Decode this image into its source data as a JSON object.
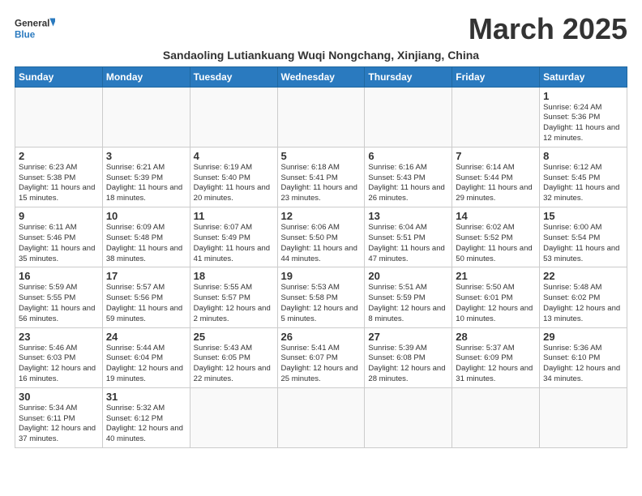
{
  "header": {
    "logo_general": "General",
    "logo_blue": "Blue",
    "month_title": "March 2025",
    "subtitle": "Sandaoling Lutiankuang Wuqi Nongchang, Xinjiang, China"
  },
  "weekdays": [
    "Sunday",
    "Monday",
    "Tuesday",
    "Wednesday",
    "Thursday",
    "Friday",
    "Saturday"
  ],
  "weeks": [
    [
      {
        "day": "",
        "info": ""
      },
      {
        "day": "",
        "info": ""
      },
      {
        "day": "",
        "info": ""
      },
      {
        "day": "",
        "info": ""
      },
      {
        "day": "",
        "info": ""
      },
      {
        "day": "",
        "info": ""
      },
      {
        "day": "1",
        "info": "Sunrise: 6:24 AM\nSunset: 5:36 PM\nDaylight: 11 hours\nand 12 minutes."
      }
    ],
    [
      {
        "day": "2",
        "info": "Sunrise: 6:23 AM\nSunset: 5:38 PM\nDaylight: 11 hours\nand 15 minutes."
      },
      {
        "day": "3",
        "info": "Sunrise: 6:21 AM\nSunset: 5:39 PM\nDaylight: 11 hours\nand 18 minutes."
      },
      {
        "day": "4",
        "info": "Sunrise: 6:19 AM\nSunset: 5:40 PM\nDaylight: 11 hours\nand 20 minutes."
      },
      {
        "day": "5",
        "info": "Sunrise: 6:18 AM\nSunset: 5:41 PM\nDaylight: 11 hours\nand 23 minutes."
      },
      {
        "day": "6",
        "info": "Sunrise: 6:16 AM\nSunset: 5:43 PM\nDaylight: 11 hours\nand 26 minutes."
      },
      {
        "day": "7",
        "info": "Sunrise: 6:14 AM\nSunset: 5:44 PM\nDaylight: 11 hours\nand 29 minutes."
      },
      {
        "day": "8",
        "info": "Sunrise: 6:12 AM\nSunset: 5:45 PM\nDaylight: 11 hours\nand 32 minutes."
      }
    ],
    [
      {
        "day": "9",
        "info": "Sunrise: 6:11 AM\nSunset: 5:46 PM\nDaylight: 11 hours\nand 35 minutes."
      },
      {
        "day": "10",
        "info": "Sunrise: 6:09 AM\nSunset: 5:48 PM\nDaylight: 11 hours\nand 38 minutes."
      },
      {
        "day": "11",
        "info": "Sunrise: 6:07 AM\nSunset: 5:49 PM\nDaylight: 11 hours\nand 41 minutes."
      },
      {
        "day": "12",
        "info": "Sunrise: 6:06 AM\nSunset: 5:50 PM\nDaylight: 11 hours\nand 44 minutes."
      },
      {
        "day": "13",
        "info": "Sunrise: 6:04 AM\nSunset: 5:51 PM\nDaylight: 11 hours\nand 47 minutes."
      },
      {
        "day": "14",
        "info": "Sunrise: 6:02 AM\nSunset: 5:52 PM\nDaylight: 11 hours\nand 50 minutes."
      },
      {
        "day": "15",
        "info": "Sunrise: 6:00 AM\nSunset: 5:54 PM\nDaylight: 11 hours\nand 53 minutes."
      }
    ],
    [
      {
        "day": "16",
        "info": "Sunrise: 5:59 AM\nSunset: 5:55 PM\nDaylight: 11 hours\nand 56 minutes."
      },
      {
        "day": "17",
        "info": "Sunrise: 5:57 AM\nSunset: 5:56 PM\nDaylight: 11 hours\nand 59 minutes."
      },
      {
        "day": "18",
        "info": "Sunrise: 5:55 AM\nSunset: 5:57 PM\nDaylight: 12 hours\nand 2 minutes."
      },
      {
        "day": "19",
        "info": "Sunrise: 5:53 AM\nSunset: 5:58 PM\nDaylight: 12 hours\nand 5 minutes."
      },
      {
        "day": "20",
        "info": "Sunrise: 5:51 AM\nSunset: 5:59 PM\nDaylight: 12 hours\nand 8 minutes."
      },
      {
        "day": "21",
        "info": "Sunrise: 5:50 AM\nSunset: 6:01 PM\nDaylight: 12 hours\nand 10 minutes."
      },
      {
        "day": "22",
        "info": "Sunrise: 5:48 AM\nSunset: 6:02 PM\nDaylight: 12 hours\nand 13 minutes."
      }
    ],
    [
      {
        "day": "23",
        "info": "Sunrise: 5:46 AM\nSunset: 6:03 PM\nDaylight: 12 hours\nand 16 minutes."
      },
      {
        "day": "24",
        "info": "Sunrise: 5:44 AM\nSunset: 6:04 PM\nDaylight: 12 hours\nand 19 minutes."
      },
      {
        "day": "25",
        "info": "Sunrise: 5:43 AM\nSunset: 6:05 PM\nDaylight: 12 hours\nand 22 minutes."
      },
      {
        "day": "26",
        "info": "Sunrise: 5:41 AM\nSunset: 6:07 PM\nDaylight: 12 hours\nand 25 minutes."
      },
      {
        "day": "27",
        "info": "Sunrise: 5:39 AM\nSunset: 6:08 PM\nDaylight: 12 hours\nand 28 minutes."
      },
      {
        "day": "28",
        "info": "Sunrise: 5:37 AM\nSunset: 6:09 PM\nDaylight: 12 hours\nand 31 minutes."
      },
      {
        "day": "29",
        "info": "Sunrise: 5:36 AM\nSunset: 6:10 PM\nDaylight: 12 hours\nand 34 minutes."
      }
    ],
    [
      {
        "day": "30",
        "info": "Sunrise: 5:34 AM\nSunset: 6:11 PM\nDaylight: 12 hours\nand 37 minutes."
      },
      {
        "day": "31",
        "info": "Sunrise: 5:32 AM\nSunset: 6:12 PM\nDaylight: 12 hours\nand 40 minutes."
      },
      {
        "day": "",
        "info": ""
      },
      {
        "day": "",
        "info": ""
      },
      {
        "day": "",
        "info": ""
      },
      {
        "day": "",
        "info": ""
      },
      {
        "day": "",
        "info": ""
      }
    ]
  ]
}
